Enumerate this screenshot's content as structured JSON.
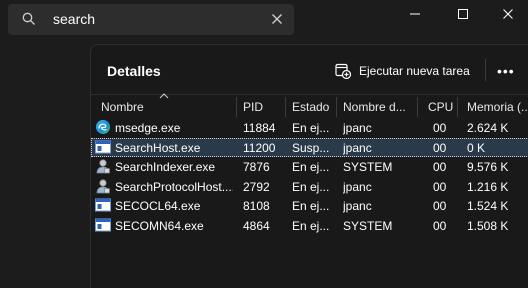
{
  "titlebar": {
    "search": {
      "value": "search"
    }
  },
  "panel": {
    "title": "Detalles",
    "run_task_label": "Ejecutar nueva tarea",
    "more_label": "•••"
  },
  "columns": {
    "name": "Nombre",
    "pid": "PID",
    "status": "Estado",
    "user": "Nombre d...",
    "cpu": "CPU",
    "memory": "Memoria (..."
  },
  "processes": [
    {
      "name": "msedge.exe",
      "pid": "11884",
      "status": "En ej...",
      "user": "jpanc",
      "cpu": "00",
      "memory": "2.624 K",
      "icon": "edge-icon"
    },
    {
      "name": "SearchHost.exe",
      "pid": "11200",
      "status": "Susp...",
      "user": "jpanc",
      "cpu": "00",
      "memory": "0 K",
      "icon": "app-window-icon",
      "selected": true
    },
    {
      "name": "SearchIndexer.exe",
      "pid": "7876",
      "status": "En ej...",
      "user": "SYSTEM",
      "cpu": "00",
      "memory": "9.576 K",
      "icon": "user-service-icon"
    },
    {
      "name": "SearchProtocolHost....",
      "pid": "2792",
      "status": "En ej...",
      "user": "jpanc",
      "cpu": "00",
      "memory": "1.216 K",
      "icon": "user-service-icon"
    },
    {
      "name": "SECOCL64.exe",
      "pid": "8108",
      "status": "En ej...",
      "user": "jpanc",
      "cpu": "00",
      "memory": "1.524 K",
      "icon": "app-window-icon"
    },
    {
      "name": "SECOMN64.exe",
      "pid": "4864",
      "status": "En ej...",
      "user": "SYSTEM",
      "cpu": "00",
      "memory": "1.508 K",
      "icon": "app-window-icon"
    }
  ],
  "colors": {
    "background": "#1c1c1c",
    "panel": "#191919",
    "selection": "#2b3a4a"
  }
}
